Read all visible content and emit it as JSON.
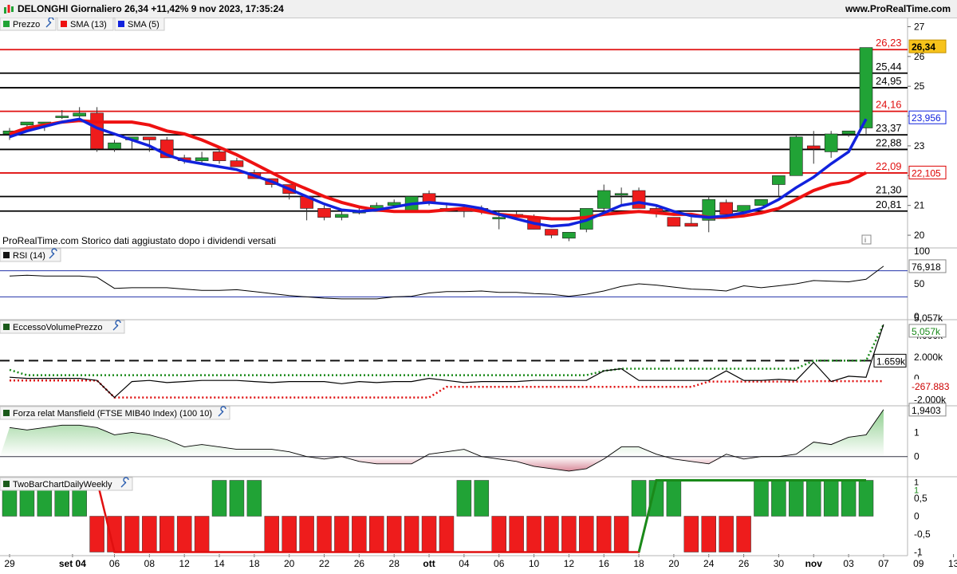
{
  "header": {
    "title": "DELONGHI Giornaliero 26,34 +11,42% 9 nov 2023, 17:35:24",
    "site": "www.ProRealTime.com"
  },
  "colors": {
    "up": "#21a336",
    "down": "#ee1c1c",
    "sma13": "#ee1111",
    "sma5": "#1122dd",
    "tag": "#f7c31b",
    "blue_text": "#1c4bd6"
  },
  "icons": [
    "wrench-icon",
    "legend-swatch-icon",
    "info-icon",
    "app-logo-icon"
  ],
  "price_panel": {
    "legend": {
      "price": "Prezzo",
      "sma13": "SMA (13)",
      "sma5": "SMA (5)"
    },
    "note": "ProRealTime.com  Storico dati aggiustato dopo i dividendi versati",
    "axis_ticks": [
      "27",
      "26",
      "25",
      "24",
      "23",
      "22",
      "21",
      "20"
    ],
    "last_price_tag": "26,34",
    "sma5_tag": "23,956",
    "sma13_tag": "22,105",
    "levels": [
      {
        "value": 26.23,
        "label": "26,23",
        "color": "red"
      },
      {
        "value": 25.44,
        "label": "25,44",
        "color": "black"
      },
      {
        "value": 24.95,
        "label": "24,95",
        "color": "black"
      },
      {
        "value": 24.16,
        "label": "24,16",
        "color": "red"
      },
      {
        "value": 23.37,
        "label": "23,37",
        "color": "black"
      },
      {
        "value": 22.88,
        "label": "22,88",
        "color": "black"
      },
      {
        "value": 22.09,
        "label": "22,09",
        "color": "red"
      },
      {
        "value": 21.3,
        "label": "21,30",
        "color": "black"
      },
      {
        "value": 20.81,
        "label": "20,81",
        "color": "black"
      }
    ]
  },
  "rsi_panel": {
    "legend": "RSI (14)",
    "axis_ticks": [
      "100",
      "50",
      "0"
    ],
    "last_tag": "76,918"
  },
  "evp_panel": {
    "legend": "EccessoVolumePrezzo",
    "axis_ticks": [
      "4.000k",
      "2.000k",
      "0",
      "-2.000k"
    ],
    "top_tag": "5,057k",
    "top_tag_green": "5,057k",
    "mid_tag": "1.659k",
    "low_tag": "-267.883"
  },
  "mansfield_panel": {
    "legend": "Forza relat Mansfield (FTSE MIB40 Index) (100 10)",
    "axis_ticks": [
      "1",
      "0"
    ],
    "last_tag": "1,9403"
  },
  "twobar_panel": {
    "legend": "TwoBarChartDailyWeekly",
    "axis_ticks": [
      "0,5",
      "0",
      "-0,5",
      "-1"
    ],
    "top_tag_a": "1",
    "top_tag_b": "1"
  },
  "x_axis_labels": [
    {
      "i": 0,
      "label": "29"
    },
    {
      "i": 3.6,
      "label": "set 04"
    },
    {
      "i": 6,
      "label": "06"
    },
    {
      "i": 8,
      "label": "08"
    },
    {
      "i": 10,
      "label": "12"
    },
    {
      "i": 12,
      "label": "14"
    },
    {
      "i": 14,
      "label": "18"
    },
    {
      "i": 16,
      "label": "20"
    },
    {
      "i": 18,
      "label": "22"
    },
    {
      "i": 20,
      "label": "26"
    },
    {
      "i": 22,
      "label": "28"
    },
    {
      "i": 24,
      "label": "ott"
    },
    {
      "i": 26,
      "label": "04"
    },
    {
      "i": 28,
      "label": "06"
    },
    {
      "i": 30,
      "label": "10"
    },
    {
      "i": 32,
      "label": "12"
    },
    {
      "i": 34,
      "label": "16"
    },
    {
      "i": 36,
      "label": "18"
    },
    {
      "i": 38,
      "label": "20"
    },
    {
      "i": 40,
      "label": "24"
    },
    {
      "i": 42,
      "label": "26"
    },
    {
      "i": 44,
      "label": "30"
    },
    {
      "i": 46,
      "label": "nov"
    },
    {
      "i": 48,
      "label": "03"
    },
    {
      "i": 50,
      "label": "07"
    },
    {
      "i": 52,
      "label": "09"
    },
    {
      "i": 54,
      "label": "13"
    }
  ],
  "chart_data": [
    {
      "type": "candlestick",
      "title": "DELONGHI Giornaliero",
      "ylim": [
        19.6,
        27.2
      ],
      "series": [
        {
          "name": "Prezzo",
          "ohlc": [
            [
              23.4,
              23.6,
              23.2,
              23.5
            ],
            [
              23.7,
              23.8,
              23.6,
              23.8
            ],
            [
              23.8,
              23.8,
              23.5,
              23.8
            ],
            [
              24.0,
              24.2,
              23.9,
              24.0
            ],
            [
              24.0,
              24.3,
              23.8,
              24.1
            ],
            [
              24.1,
              24.3,
              22.8,
              22.9
            ],
            [
              22.9,
              23.2,
              22.8,
              23.1
            ],
            [
              23.2,
              23.3,
              22.9,
              23.3
            ],
            [
              23.3,
              23.3,
              22.8,
              23.2
            ],
            [
              23.2,
              23.3,
              22.7,
              22.6
            ],
            [
              22.6,
              22.7,
              22.4,
              22.5
            ],
            [
              22.5,
              22.8,
              22.4,
              22.6
            ],
            [
              22.8,
              22.9,
              22.4,
              22.5
            ],
            [
              22.5,
              22.6,
              22.3,
              22.3
            ],
            [
              22.1,
              22.2,
              21.9,
              21.9
            ],
            [
              21.9,
              21.9,
              21.6,
              21.7
            ],
            [
              21.7,
              21.7,
              21.2,
              21.4
            ],
            [
              21.3,
              21.3,
              20.5,
              20.9
            ],
            [
              20.9,
              21.0,
              20.5,
              20.6
            ],
            [
              20.6,
              20.8,
              20.5,
              20.7
            ],
            [
              20.8,
              21.0,
              20.7,
              20.8
            ],
            [
              20.8,
              21.1,
              20.8,
              21.0
            ],
            [
              21.0,
              21.2,
              21.0,
              21.1
            ],
            [
              20.8,
              21.3,
              20.8,
              21.3
            ],
            [
              21.4,
              21.5,
              21.0,
              21.1
            ],
            [
              20.9,
              21.1,
              20.8,
              20.9
            ],
            [
              20.9,
              21.0,
              20.6,
              20.8
            ],
            [
              20.9,
              21.0,
              20.7,
              20.8
            ],
            [
              20.6,
              20.8,
              20.2,
              20.6
            ],
            [
              20.7,
              20.8,
              20.6,
              20.7
            ],
            [
              20.6,
              20.7,
              20.2,
              20.2
            ],
            [
              20.2,
              20.2,
              19.9,
              20.0
            ],
            [
              19.9,
              20.1,
              19.8,
              20.1
            ],
            [
              20.2,
              20.9,
              20.1,
              20.9
            ],
            [
              20.9,
              21.7,
              20.8,
              21.5
            ],
            [
              21.4,
              21.6,
              21.0,
              21.4
            ],
            [
              21.5,
              21.6,
              20.9,
              20.9
            ],
            [
              20.9,
              21.0,
              20.6,
              20.8
            ],
            [
              20.6,
              20.6,
              20.3,
              20.3
            ],
            [
              20.4,
              20.6,
              20.3,
              20.3
            ],
            [
              20.5,
              21.3,
              20.1,
              21.2
            ],
            [
              21.1,
              21.2,
              20.6,
              20.7
            ],
            [
              20.8,
              21.0,
              20.7,
              21.0
            ],
            [
              21.0,
              21.2,
              21.0,
              21.2
            ],
            [
              21.7,
              21.8,
              21.3,
              22.0
            ],
            [
              22.0,
              23.4,
              22.0,
              23.3
            ],
            [
              23.0,
              23.5,
              22.4,
              22.9
            ],
            [
              22.8,
              23.5,
              22.6,
              23.4
            ],
            [
              23.4,
              23.4,
              23.3,
              23.5
            ],
            [
              23.6,
              26.3,
              23.4,
              26.3
            ]
          ]
        }
      ]
    },
    {
      "type": "line",
      "title": "SMA (13) / SMA (5)",
      "series": [
        {
          "name": "SMA (13)",
          "values": [
            23.4,
            23.6,
            23.7,
            23.8,
            23.85,
            23.8,
            23.8,
            23.8,
            23.7,
            23.5,
            23.4,
            23.2,
            22.95,
            22.7,
            22.4,
            22.1,
            21.8,
            21.55,
            21.3,
            21.1,
            20.95,
            20.85,
            20.8,
            20.8,
            20.8,
            20.85,
            20.9,
            20.8,
            20.7,
            20.65,
            20.6,
            20.55,
            20.55,
            20.6,
            20.7,
            20.75,
            20.8,
            20.75,
            20.7,
            20.7,
            20.6,
            20.6,
            20.65,
            20.75,
            20.9,
            21.2,
            21.5,
            21.7,
            21.8,
            22.1
          ]
        },
        {
          "name": "SMA (5)",
          "values": [
            23.3,
            23.5,
            23.65,
            23.8,
            23.9,
            23.6,
            23.4,
            23.2,
            23.0,
            22.7,
            22.5,
            22.4,
            22.3,
            22.2,
            22.0,
            21.8,
            21.55,
            21.3,
            21.05,
            20.85,
            20.8,
            20.85,
            20.95,
            21.05,
            21.1,
            21.05,
            21.0,
            20.9,
            20.7,
            20.55,
            20.4,
            20.3,
            20.35,
            20.5,
            20.75,
            21.0,
            21.1,
            21.0,
            20.8,
            20.65,
            20.6,
            20.65,
            20.75,
            20.9,
            21.2,
            21.6,
            21.95,
            22.4,
            22.8,
            23.9
          ]
        }
      ]
    },
    {
      "type": "line",
      "title": "RSI (14)",
      "ylim": [
        0,
        100
      ],
      "series": [
        {
          "name": "RSI (14)",
          "values": [
            62,
            63,
            62,
            62,
            62,
            60,
            43,
            44,
            44,
            44,
            42,
            40,
            40,
            41,
            38,
            35,
            32,
            30,
            28,
            27,
            27,
            27,
            30,
            31,
            36,
            38,
            38,
            39,
            37,
            37,
            35,
            34,
            31,
            34,
            39,
            46,
            50,
            48,
            45,
            42,
            41,
            39,
            47,
            44,
            47,
            50,
            55,
            54,
            53,
            57,
            76.918
          ]
        }
      ]
    },
    {
      "type": "line",
      "title": "EccessoVolumePrezzo",
      "ylim": [
        -2500,
        5500
      ],
      "series": [
        {
          "name": "EccessoVolumePrezzo",
          "values": [
            100,
            0,
            0,
            0,
            0,
            -200,
            -1800,
            -300,
            -200,
            -400,
            -300,
            -200,
            -200,
            -200,
            -300,
            -400,
            -300,
            -300,
            -300,
            -500,
            -300,
            -400,
            -300,
            -300,
            0,
            -200,
            -400,
            -300,
            -300,
            -300,
            -200,
            -200,
            -200,
            -200,
            700,
            900,
            -200,
            -200,
            -200,
            -200,
            -200,
            700,
            -200,
            -200,
            -100,
            -200,
            1500,
            -300,
            200,
            100,
            5057
          ]
        },
        {
          "name": "EccessoVolumePrezzo (verde)",
          "values": [
            800,
            300,
            300,
            300,
            300,
            300,
            300,
            300,
            300,
            300,
            300,
            300,
            300,
            300,
            300,
            300,
            300,
            300,
            300,
            300,
            300,
            300,
            300,
            300,
            300,
            300,
            300,
            300,
            300,
            300,
            300,
            300,
            300,
            300,
            700,
            900,
            900,
            900,
            900,
            900,
            900,
            900,
            900,
            900,
            900,
            900,
            1659,
            1659,
            1659,
            1659,
            5057
          ]
        },
        {
          "name": "EccessoVolumePrezzo (rosso)",
          "values": [
            -200,
            -200,
            -200,
            -200,
            -200,
            -200,
            -1800,
            -1800,
            -1800,
            -1800,
            -1800,
            -1800,
            -1800,
            -1800,
            -1800,
            -1800,
            -1800,
            -1800,
            -1800,
            -1800,
            -1800,
            -1800,
            -1800,
            -1800,
            -1800,
            -800,
            -800,
            -800,
            -800,
            -800,
            -800,
            -800,
            -800,
            -800,
            -800,
            -800,
            -800,
            -800,
            -800,
            -800,
            -300,
            -300,
            -300,
            -300,
            -300,
            -300,
            -268,
            -268,
            -268,
            -268,
            -268
          ]
        }
      ]
    },
    {
      "type": "area",
      "title": "Forza relat Mansfield (FTSE MIB40 Index) (100 10)",
      "ylim": [
        -0.8,
        2.1
      ],
      "series": [
        {
          "name": "Forza relat Mansfield",
          "values": [
            1.2,
            1.1,
            1.2,
            1.3,
            1.3,
            1.2,
            0.9,
            1.0,
            0.9,
            0.7,
            0.4,
            0.5,
            0.4,
            0.3,
            0.3,
            0.3,
            0.2,
            0.0,
            -0.1,
            0.0,
            -0.2,
            -0.3,
            -0.3,
            -0.3,
            0.1,
            0.2,
            0.3,
            0.0,
            -0.1,
            -0.2,
            -0.4,
            -0.5,
            -0.6,
            -0.5,
            -0.1,
            0.4,
            0.4,
            0.1,
            -0.1,
            -0.2,
            -0.3,
            0.1,
            -0.1,
            0.0,
            0.0,
            0.1,
            0.6,
            0.5,
            0.8,
            0.9,
            1.9403
          ]
        }
      ]
    },
    {
      "type": "bar",
      "title": "TwoBarChartDailyWeekly",
      "ylim": [
        -1.1,
        1.1
      ],
      "series": [
        {
          "name": "TwoBarChartDailyWeekly (barre)",
          "values": [
            1,
            1,
            1,
            1,
            1,
            -1,
            -1,
            -1,
            -1,
            -1,
            -1,
            -1,
            1,
            1,
            1,
            -1,
            -1,
            -1,
            -1,
            -1,
            -1,
            -1,
            -1,
            -1,
            -1,
            -1,
            1,
            1,
            -1,
            -1,
            -1,
            -1,
            -1,
            -1,
            -1,
            -1,
            1,
            1,
            1,
            -1,
            -1,
            -1,
            -1,
            1,
            1,
            1,
            1,
            1,
            1,
            1,
            1,
            1
          ]
        },
        {
          "name": "TwoBarChartDailyWeekly (linea)",
          "values": [
            1,
            1,
            1,
            1,
            1,
            1,
            -1,
            -1,
            -1,
            -1,
            -1,
            -1,
            -1,
            -1,
            -1,
            -1,
            -1,
            -1,
            -1,
            -1,
            -1,
            -1,
            -1,
            -1,
            -1,
            -1,
            -1,
            -1,
            -1,
            -1,
            -1,
            -1,
            -1,
            -1,
            -1,
            -1,
            -1,
            1,
            1,
            1,
            1,
            1,
            1,
            1,
            1,
            1,
            1,
            1,
            1,
            1,
            1,
            1
          ]
        }
      ]
    }
  ]
}
